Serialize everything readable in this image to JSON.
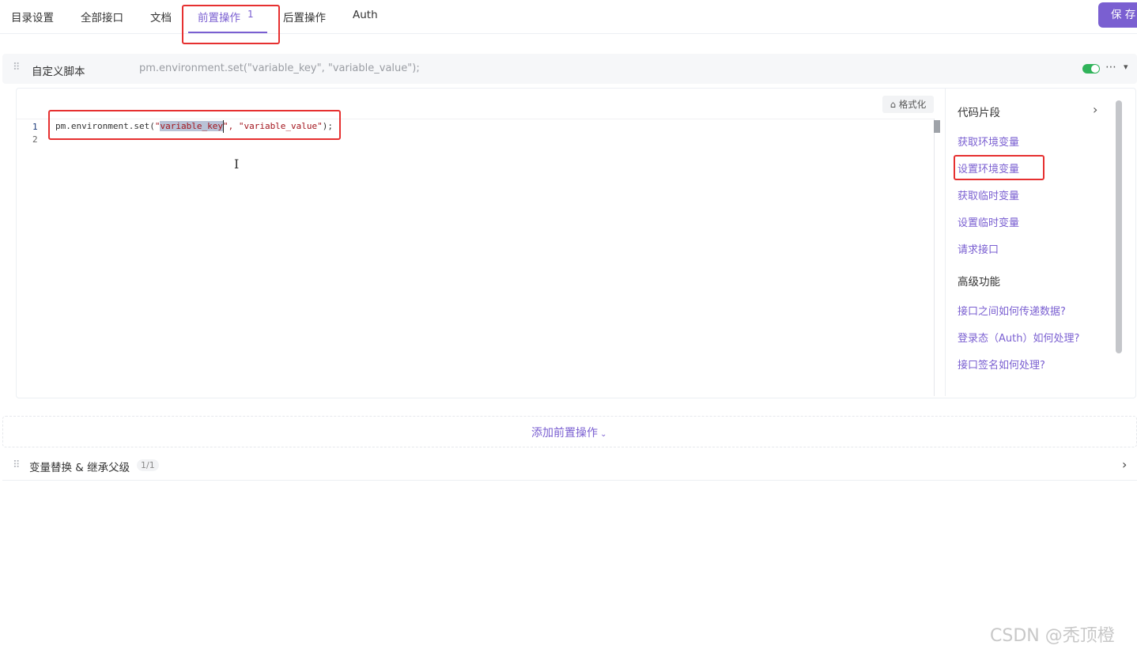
{
  "tabs": [
    {
      "label": "目录设置"
    },
    {
      "label": "全部接口"
    },
    {
      "label": "文档"
    },
    {
      "label": "前置操作",
      "badge": "1",
      "active": true
    },
    {
      "label": "后置操作"
    },
    {
      "label": "Auth"
    }
  ],
  "toolbar": {
    "save_label": "保 存"
  },
  "script_card": {
    "title": "自定义脚本",
    "preview": "pm.environment.set(\"variable_key\", \"variable_value\");",
    "enabled": true,
    "more_icon": "ellipsis-icon",
    "collapse_icon": "chevron-down-icon"
  },
  "editor": {
    "format_label": "格式化",
    "format_icon": "broom-icon",
    "line_numbers": [
      "1",
      "2"
    ],
    "code": {
      "prefix": "pm.environment.set(",
      "quote_open": "\"",
      "selected": "variable_key",
      "after_key": "\", ",
      "value_string": "\"variable_value\"",
      "suffix": ");"
    }
  },
  "snippets": {
    "title": "代码片段",
    "items": [
      "获取环境变量",
      "设置环境变量",
      "获取临时变量",
      "设置临时变量",
      "请求接口"
    ],
    "advanced_title": "高级功能",
    "advanced_items": [
      "接口之间如何传递数据?",
      "登录态（Auth）如何处理?",
      "接口签名如何处理?"
    ]
  },
  "add_action": {
    "label": "添加前置操作"
  },
  "variable_section": {
    "title": "变量替换 & 继承父级",
    "count": "1/1"
  },
  "watermark": "CSDN @秃顶橙",
  "colors": {
    "accent": "#7a5fd1",
    "highlight": "#e63030",
    "toggle_on": "#30b35a"
  }
}
